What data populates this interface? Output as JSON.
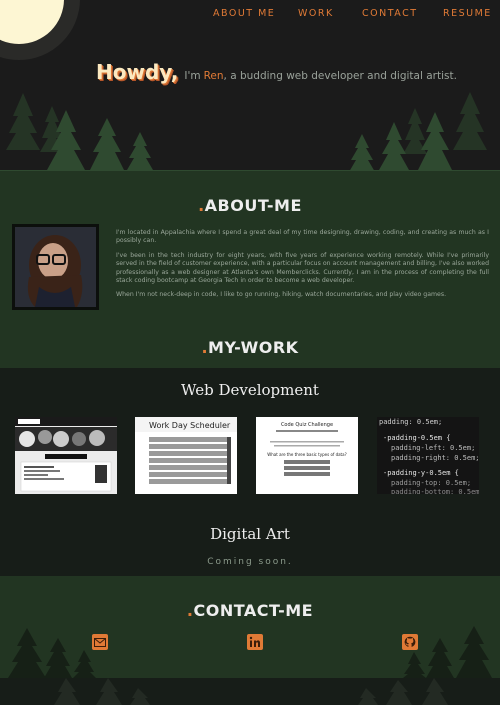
{
  "nav": {
    "items": [
      "ABOUT ME",
      "WORK",
      "CONTACT",
      "RESUME"
    ]
  },
  "hero": {
    "greeting": "Howdy,",
    "intro_pre": "I'm",
    "name": "Ren",
    "intro_post": ", a budding web developer and digital artist."
  },
  "about": {
    "title_dot": ".",
    "title": "ABOUT-ME",
    "paragraphs": [
      "I'm located in Appalachia where I spend a great deal of my time designing, drawing, coding, and creating as much as I possibly can.",
      "I've been in the tech industry for eight years, with five years of experience working remotely. While I've primarily served in the field of customer experience, with a particular focus on account management and billing, I've also worked professionally as a web designer at Atlanta's own Memberclicks. Currently, I am in the process of completing the full stack coding bootcamp at Georgia Tech in order to become a web developer.",
      "When I'm not neck-deep in code, I like to go running, hiking, watch documentaries, and play video games."
    ]
  },
  "work": {
    "title_dot": ".",
    "title": "MY-WORK",
    "web_title": "Web Development",
    "projects": [
      {
        "label": "Bingeworthy"
      },
      {
        "label": "Work Day Scheduler"
      },
      {
        "label": "Code Quiz Challenge",
        "question": "What are the three basic types of data?"
      },
      {
        "label": "code-snippet"
      }
    ],
    "art_title": "Digital Art",
    "art_status": "Coming soon."
  },
  "contact": {
    "title_dot": ".",
    "title": "CONTACT-ME",
    "links": [
      "email-icon",
      "linkedin-icon",
      "github-icon"
    ]
  },
  "colors": {
    "accent": "#e07a36",
    "green": "#223522",
    "dark": "#171d18"
  }
}
